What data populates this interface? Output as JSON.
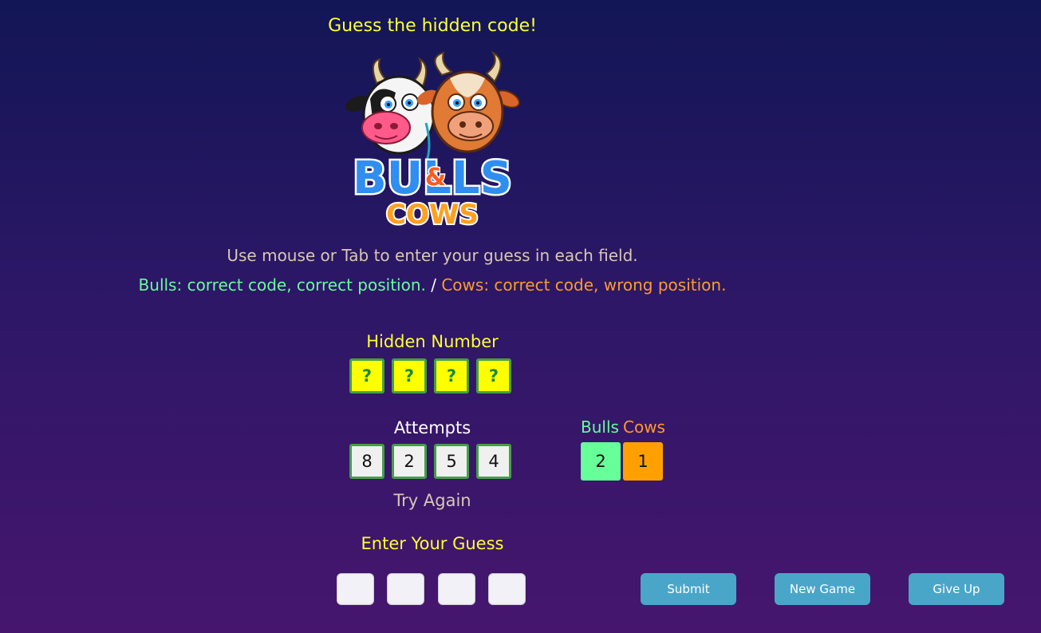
{
  "header": {
    "title": "Guess the hidden code!"
  },
  "logo": {
    "icon": "bulls-and-cows-logo",
    "line1": "BULLS",
    "amp": "&",
    "line2": "COWS"
  },
  "instructions": {
    "text": "Use mouse or Tab to enter your guess in each field.",
    "bulls_text": "Bulls: correct code, correct position.",
    "separator": "/",
    "cows_text": "Cows: correct code, wrong position."
  },
  "hidden": {
    "label": "Hidden Number",
    "digits": [
      "?",
      "?",
      "?",
      "?"
    ]
  },
  "attempts": {
    "label": "Attempts",
    "digits": [
      "8",
      "2",
      "5",
      "4"
    ],
    "status": "Try Again"
  },
  "score": {
    "bulls_label": "Bulls",
    "cows_label": "Cows",
    "bulls_count": "2",
    "cows_count": "1"
  },
  "guess": {
    "label": "Enter Your Guess",
    "values": [
      "",
      "",
      "",
      ""
    ]
  },
  "buttons": {
    "submit": "Submit",
    "new_game": "New Game",
    "give_up": "Give Up"
  },
  "colors": {
    "background_top": "#121656",
    "background_bottom": "#46166e",
    "accent_yellow": "#ffff33",
    "bulls_green": "#66ff99",
    "cows_orange": "#ffa000",
    "button_blue": "#4aa6c9"
  }
}
